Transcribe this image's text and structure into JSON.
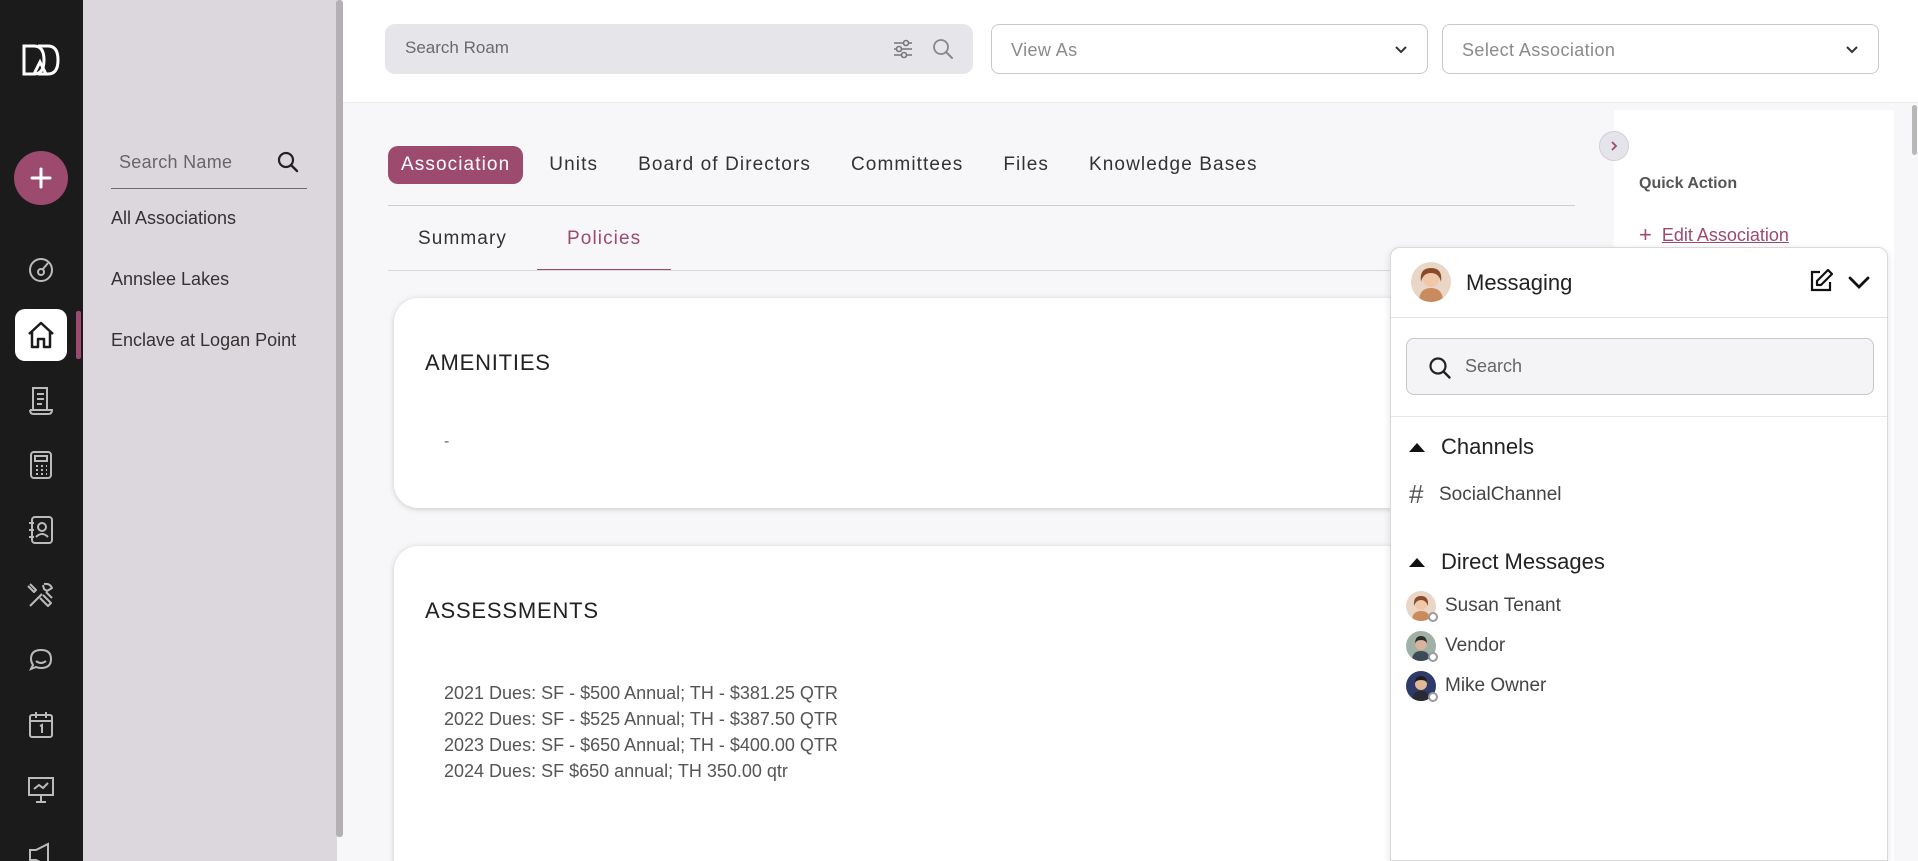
{
  "colors": {
    "accent": "#9c4a6e",
    "rail": "#1b1b1b",
    "sidebar": "#dcd7dc"
  },
  "rail": {
    "items": [
      "dashboard-icon",
      "home-icon",
      "ledger-icon",
      "calculator-icon",
      "contacts-icon",
      "tools-icon",
      "chat-icon",
      "calendar-icon",
      "presentation-icon",
      "megaphone-icon"
    ],
    "active": "home-icon"
  },
  "sidebar": {
    "search_placeholder": "Search Name",
    "items": [
      {
        "label": "All Associations"
      },
      {
        "label": "Annslee Lakes"
      },
      {
        "label": "Enclave at Logan Point"
      }
    ]
  },
  "topbar": {
    "search_placeholder": "Search Roam",
    "view_as": "View As",
    "select_association": "Select Association"
  },
  "tabs": [
    {
      "label": "Association",
      "active": true
    },
    {
      "label": "Units"
    },
    {
      "label": "Board of Directors"
    },
    {
      "label": "Committees"
    },
    {
      "label": "Files"
    },
    {
      "label": "Knowledge Bases"
    }
  ],
  "subtabs": [
    {
      "label": "Summary"
    },
    {
      "label": "Policies",
      "active": true
    }
  ],
  "amenities": {
    "title": "AMENITIES",
    "value": "-"
  },
  "assessments": {
    "title": "ASSESSMENTS",
    "lines": [
      "2021 Dues: SF - $500 Annual; TH - $381.25 QTR",
      "2022 Dues: SF - $525 Annual; TH - $387.50 QTR",
      "2023 Dues: SF - $650 Annual; TH - $400.00 QTR",
      "2024 Dues: SF $650 annual; TH 350.00 qtr"
    ]
  },
  "quick_action": {
    "title": "Quick Action",
    "edit_label": "Edit Association"
  },
  "messaging": {
    "title": "Messaging",
    "search_placeholder": "Search",
    "channels_label": "Channels",
    "channels": [
      "SocialChannel"
    ],
    "dm_label": "Direct Messages",
    "direct_messages": [
      "Susan Tenant",
      "Vendor",
      "Mike Owner"
    ]
  }
}
